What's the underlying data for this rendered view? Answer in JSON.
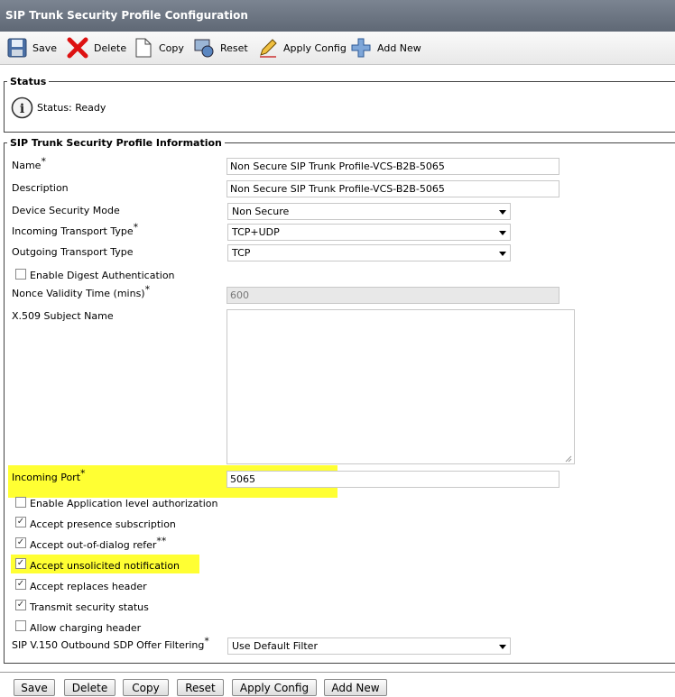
{
  "title": "SIP Trunk Security Profile Configuration",
  "toolbar": {
    "save": "Save",
    "delete": "Delete",
    "copy": "Copy",
    "reset": "Reset",
    "apply_config": "Apply Config",
    "add_new": "Add New"
  },
  "status": {
    "legend": "Status",
    "text": "Status: Ready"
  },
  "info": {
    "legend": "SIP Trunk Security Profile Information",
    "name_label": "Name",
    "name_value": "Non Secure SIP Trunk Profile-VCS-B2B-5065",
    "description_label": "Description",
    "description_value": "Non Secure SIP Trunk Profile-VCS-B2B-5065",
    "device_security_mode_label": "Device Security Mode",
    "device_security_mode_value": "Non Secure",
    "incoming_transport_label": "Incoming Transport Type",
    "incoming_transport_value": "TCP+UDP",
    "outgoing_transport_label": "Outgoing Transport Type",
    "outgoing_transport_value": "TCP",
    "digest_auth_label": "Enable Digest Authentication",
    "nonce_label": "Nonce Validity Time (mins)",
    "nonce_value": "600",
    "x509_label": "X.509 Subject Name",
    "x509_value": "",
    "incoming_port_label": "Incoming Port",
    "incoming_port_value": "5065",
    "app_auth_label": "Enable Application level authorization",
    "presence_label": "Accept presence subscription",
    "ood_refer_label": "Accept out-of-dialog refer",
    "unsolicited_label": "Accept unsolicited notification",
    "replaces_label": "Accept replaces header",
    "transmit_label": "Transmit security status",
    "charging_label": "Allow charging header",
    "sdp_label": "SIP V.150 Outbound SDP Offer Filtering",
    "sdp_value": "Use Default Filter",
    "required_mark": "*",
    "double_mark": "**",
    "check_mark": "✓"
  },
  "checkboxes": {
    "digest_auth": false,
    "app_auth": false,
    "presence": true,
    "ood_refer": true,
    "unsolicited": true,
    "replaces": true,
    "transmit": true,
    "charging": false
  },
  "bottom": {
    "save": "Save",
    "delete": "Delete",
    "copy": "Copy",
    "reset": "Reset",
    "apply_config": "Apply Config",
    "add_new": "Add New"
  },
  "colors": {
    "highlight": "#ffff33",
    "title_bar": "#6b7482"
  }
}
